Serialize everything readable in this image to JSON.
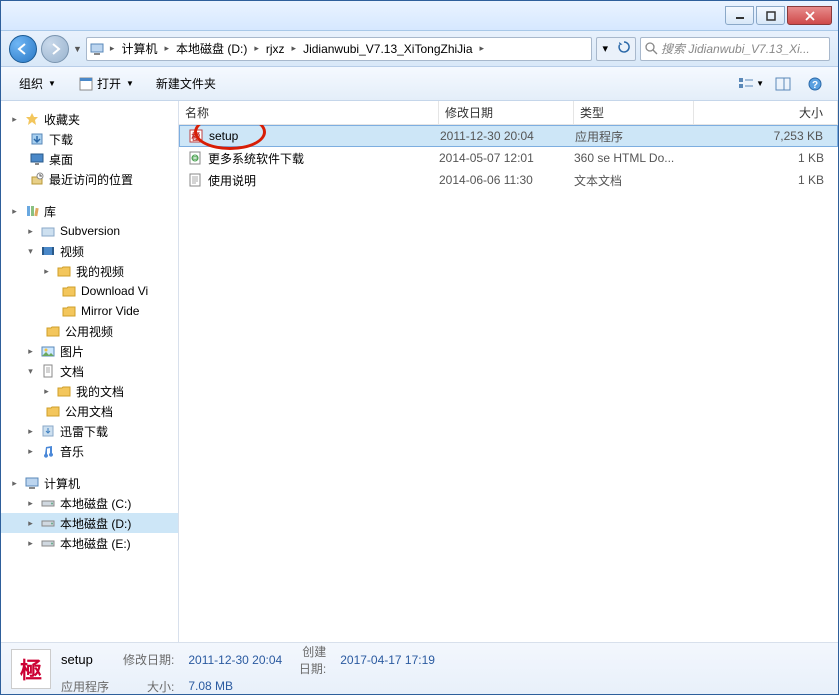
{
  "window": {
    "minimize_tip": "minimize",
    "maximize_tip": "maximize",
    "close_tip": "close"
  },
  "breadcrumb": {
    "segments": [
      "计算机",
      "本地磁盘 (D:)",
      "rjxz",
      "Jidianwubi_V7.13_XiTongZhiJia"
    ]
  },
  "search": {
    "placeholder": "搜索 Jidianwubi_V7.13_Xi..."
  },
  "toolbar": {
    "organize": "组织",
    "open": "打开",
    "new_folder": "新建文件夹"
  },
  "columns": {
    "name": "名称",
    "date": "修改日期",
    "type": "类型",
    "size": "大小"
  },
  "files": [
    {
      "name": "setup",
      "date": "2011-12-30 20:04",
      "type": "应用程序",
      "size": "7,253 KB",
      "icon": "app",
      "selected": true
    },
    {
      "name": "更多系统软件下载",
      "date": "2014-05-07 12:01",
      "type": "360 se HTML Do...",
      "size": "1 KB",
      "icon": "html",
      "selected": false
    },
    {
      "name": "使用说明",
      "date": "2014-06-06 11:30",
      "type": "文本文档",
      "size": "1 KB",
      "icon": "txt",
      "selected": false
    }
  ],
  "nav": {
    "favorites": {
      "label": "收藏夹",
      "items": [
        "下载",
        "桌面",
        "最近访问的位置"
      ]
    },
    "libraries": {
      "label": "库",
      "items": [
        {
          "label": "Subversion",
          "children": []
        },
        {
          "label": "视频",
          "children": [
            "我的视频",
            "Download Vi",
            "Mirror Vide",
            "公用视频"
          ],
          "expanded": true
        },
        {
          "label": "图片",
          "children": []
        },
        {
          "label": "文档",
          "children": [
            "我的文档",
            "公用文档"
          ],
          "expanded": true
        },
        {
          "label": "迅雷下载",
          "children": []
        },
        {
          "label": "音乐",
          "children": []
        }
      ]
    },
    "computer": {
      "label": "计算机",
      "drives": [
        "本地磁盘 (C:)",
        "本地磁盘 (D:)",
        "本地磁盘 (E:)"
      ],
      "selected": "本地磁盘 (D:)"
    }
  },
  "details": {
    "name": "setup",
    "type_label": "应用程序",
    "mod_label": "修改日期:",
    "mod_value": "2011-12-30 20:04",
    "size_label": "大小:",
    "size_value": "7.08 MB",
    "create_label": "创建日期:",
    "create_value": "2017-04-17 17:19"
  }
}
